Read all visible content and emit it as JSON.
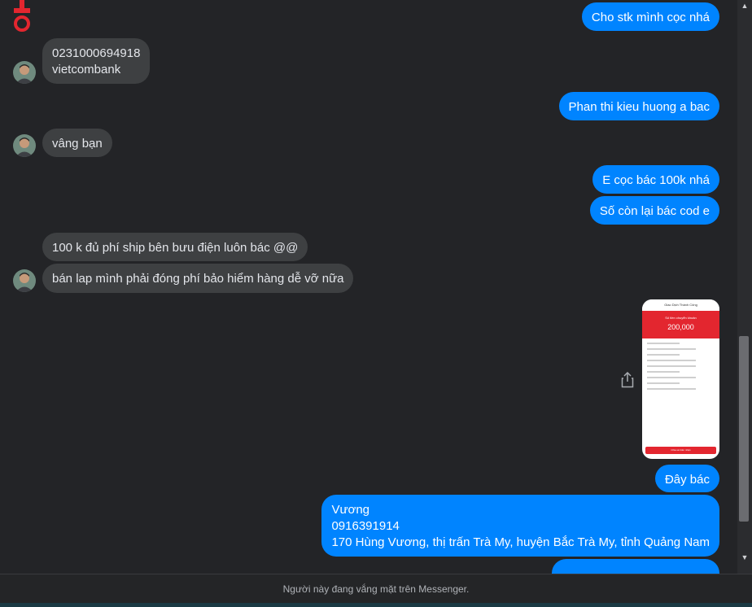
{
  "messages": [
    {
      "side": "out",
      "text": "Cho stk mình cọc nhá"
    },
    {
      "side": "in",
      "text": "0231000694918\nvietcombank"
    },
    {
      "side": "out",
      "text": "Phan thi kieu huong a bac"
    },
    {
      "side": "in",
      "text": "vâng bạn"
    },
    {
      "side": "out",
      "text": "E cọc bác 100k nhá"
    },
    {
      "side": "out",
      "text": "Số còn lại bác cod e"
    },
    {
      "side": "in",
      "text": "100 k đủ phí ship bên bưu điện luôn bác @@"
    },
    {
      "side": "in",
      "text": "bán lap mình phải đóng phí bảo hiểm hàng dễ vỡ nữa"
    },
    {
      "side": "out",
      "text": "Đây bác"
    },
    {
      "side": "out",
      "text": "Vương\n0916391914\n170 Hùng Vương, thị trấn Trà My, huyện Bắc Trà My, tỉnh Quảng Nam"
    }
  ],
  "receipt": {
    "header": "Giao Dịch Thành Công",
    "amount_label": "Số tiền chuyển khoản",
    "amount": "200,000",
    "button": "Chia sẻ biên nhận"
  },
  "footer": {
    "status": "Người này đang vắng mặt trên Messenger."
  },
  "colors": {
    "background": "#232427",
    "incoming": "#3e4042",
    "outgoing": "#0084ff",
    "logo": "#e3262f"
  },
  "icons": {
    "share": "share-icon",
    "logo": "app-logo-icon",
    "scroll_up": "scroll-up-arrow",
    "scroll_down": "scroll-down-arrow"
  }
}
